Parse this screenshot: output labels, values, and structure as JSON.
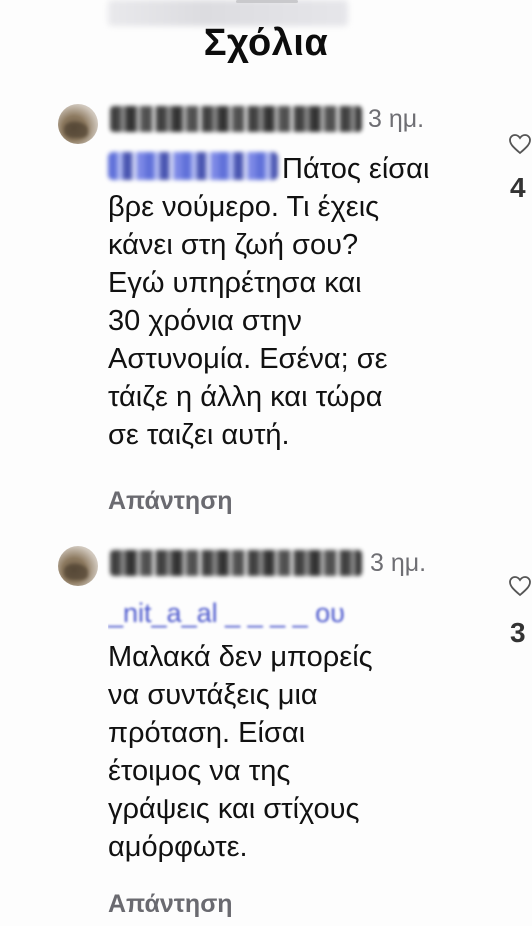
{
  "header": {
    "title": "Σχόλια"
  },
  "comments": [
    {
      "time": "3 ημ.",
      "text": "Πάτος είσαι\nβρε νούμερο. Τι έχεις\nκάνει στη ζωή σου?\nΕγώ υπηρέτησα και\n30 χρόνια στην\nΑστυνομία. Εσένα; σε\nτάιζε η άλλη και τώρα\nσε ταιζει  αυτή.",
      "reply_label": "Απάντηση",
      "like_count": "4",
      "heart_icon": "heart-outline-icon"
    },
    {
      "time": "3 ημ.",
      "mention": "_nit_a_al _ _ _ _ ου",
      "text": "Μαλακά δεν μπορείς\nνα συντάξεις μια\nπρόταση. Είσαι\nέτοιμος να της\nγράψεις και στίχους\nαμόρφωτε.",
      "reply_label": "Απάντηση",
      "like_count": "3",
      "heart_icon": "heart-outline-icon"
    }
  ]
}
